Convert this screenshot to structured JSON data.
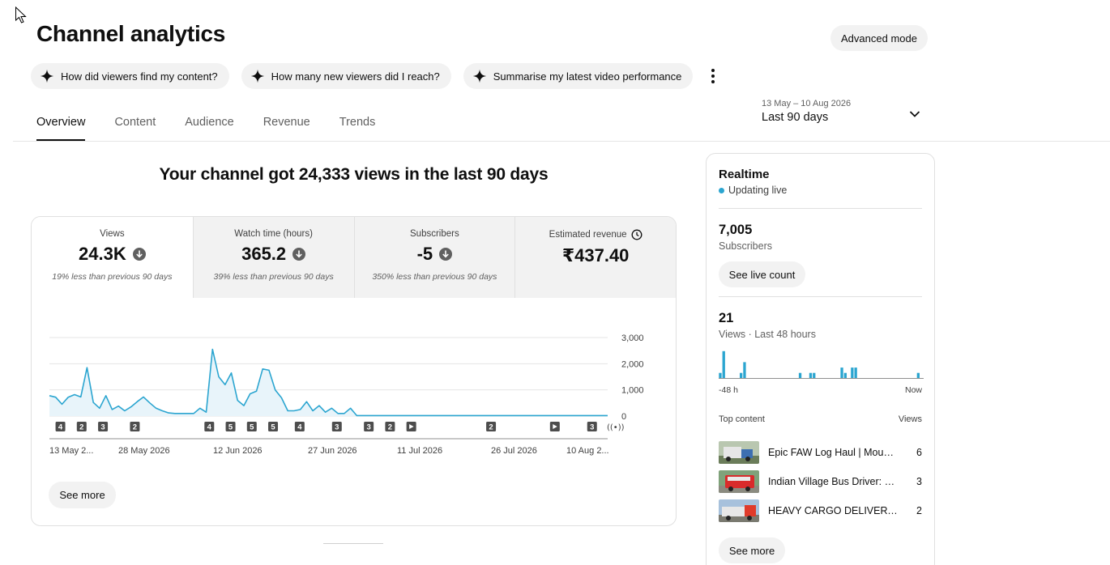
{
  "page": {
    "title": "Channel analytics",
    "advanced_mode_label": "Advanced mode"
  },
  "chips": [
    {
      "label": "How did viewers find my content?"
    },
    {
      "label": "How many new viewers did I reach?"
    },
    {
      "label": "Summarise my latest video performance"
    }
  ],
  "tabs": [
    {
      "label": "Overview",
      "active": true
    },
    {
      "label": "Content"
    },
    {
      "label": "Audience"
    },
    {
      "label": "Revenue"
    },
    {
      "label": "Trends"
    }
  ],
  "date_picker": {
    "range": "13 May – 10 Aug 2026",
    "label": "Last 90 days"
  },
  "headline": "Your channel got 24,333 views in the last 90 days",
  "metrics": [
    {
      "label": "Views",
      "value": "24.3K",
      "trend": "down",
      "sub": "19% less than previous 90 days",
      "selected": true
    },
    {
      "label": "Watch time (hours)",
      "value": "365.2",
      "trend": "down",
      "sub": "39% less than previous 90 days"
    },
    {
      "label": "Subscribers",
      "value": "-5",
      "trend": "down",
      "sub": "350% less than previous 90 days"
    },
    {
      "label": "Estimated revenue",
      "value": "₹437.40",
      "icon": "clock-icon",
      "sub": ""
    }
  ],
  "chart_data": {
    "type": "area",
    "series": [
      {
        "values": [
          780,
          720,
          450,
          720,
          820,
          730,
          1850,
          520,
          300,
          780,
          250,
          380,
          200,
          350,
          550,
          730,
          500,
          300,
          200,
          120,
          100,
          100,
          100,
          100,
          300,
          150,
          2550,
          1500,
          1200,
          1650,
          600,
          400,
          850,
          950,
          1800,
          1750,
          1000,
          700,
          200,
          200,
          250,
          550,
          200,
          400,
          150,
          300,
          100,
          100,
          300,
          20,
          20,
          20,
          20,
          20,
          20,
          20,
          20,
          20,
          20,
          20,
          20,
          20,
          20,
          20,
          20,
          20,
          20,
          20,
          20,
          20,
          20,
          20,
          20,
          20,
          20,
          20,
          20,
          20,
          20,
          20,
          20,
          20,
          20,
          20,
          20,
          20,
          20,
          20,
          20,
          20
        ]
      }
    ],
    "ylim": [
      0,
      3000
    ],
    "yticks": [
      "3,000",
      "2,000",
      "1,000",
      "0"
    ],
    "xticks": [
      "13 May 2...",
      "28 May 2026",
      "12 Jun 2026",
      "27 Jun 2026",
      "11 Jul 2026",
      "26 Jul 2026",
      "10 Aug 2..."
    ],
    "grid": true,
    "color": "#2ba5d0",
    "markers": [
      {
        "label": "4",
        "day": 1
      },
      {
        "label": "2",
        "day": 5
      },
      {
        "label": "3",
        "day": 9
      },
      {
        "label": "2",
        "day": 15
      },
      {
        "label": "4",
        "day": 29
      },
      {
        "label": "5",
        "day": 33
      },
      {
        "label": "5",
        "day": 37
      },
      {
        "label": "5",
        "day": 41
      },
      {
        "label": "4",
        "day": 46
      },
      {
        "label": "3",
        "day": 53
      },
      {
        "label": "3",
        "day": 59
      },
      {
        "label": "2",
        "day": 63
      },
      {
        "label": "video",
        "day": 67
      },
      {
        "label": "2",
        "day": 82
      },
      {
        "label": "video",
        "day": 94
      },
      {
        "label": "3",
        "day": 101
      },
      {
        "label": "live",
        "day": 105
      }
    ]
  },
  "overview_see_more": "See more",
  "realtime": {
    "title": "Realtime",
    "live_label": "Updating live",
    "subscribers_value": "7,005",
    "subscribers_label": "Subscribers",
    "see_live_count": "See live count",
    "views_value": "21",
    "views_label": "Views · Last 48 hours",
    "bars": [
      0.18,
      0.95,
      0,
      0,
      0,
      0,
      0.18,
      0.56,
      0,
      0,
      0,
      0,
      0,
      0,
      0,
      0,
      0,
      0,
      0,
      0,
      0,
      0,
      0,
      0.18,
      0,
      0,
      0.18,
      0.18,
      0,
      0,
      0,
      0,
      0,
      0,
      0,
      0.37,
      0.18,
      0,
      0.37,
      0.37,
      0,
      0,
      0,
      0,
      0,
      0,
      0,
      0,
      0,
      0,
      0,
      0,
      0,
      0,
      0,
      0,
      0,
      0.18,
      0
    ],
    "axis_start": "-48 h",
    "axis_end": "Now",
    "top_content_label": "Top content",
    "views_col_label": "Views",
    "top_content": [
      {
        "title": "Epic FAW Log Haul | Mount...",
        "views": "6"
      },
      {
        "title": "Indian Village Bus Driver: R...",
        "views": "3"
      },
      {
        "title": "HEAVY CARGO DELIVERY ...",
        "views": "2"
      }
    ],
    "see_more": "See more"
  }
}
